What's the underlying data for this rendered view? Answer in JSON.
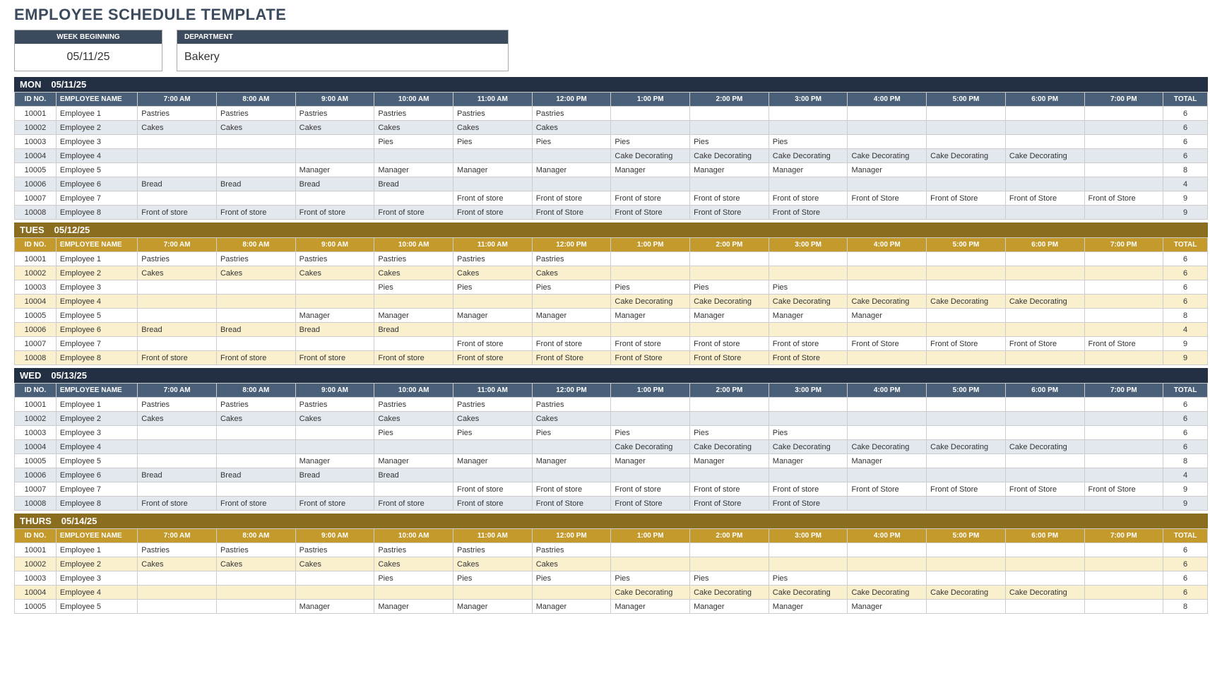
{
  "title": "EMPLOYEE SCHEDULE TEMPLATE",
  "header": {
    "week_label": "WEEK BEGINNING",
    "week_value": "05/11/25",
    "dept_label": "DEPARTMENT",
    "dept_value": "Bakery"
  },
  "columns": {
    "id": "ID NO.",
    "name": "EMPLOYEE NAME",
    "hours": [
      "7:00 AM",
      "8:00 AM",
      "9:00 AM",
      "10:00 AM",
      "11:00 AM",
      "12:00 PM",
      "1:00 PM",
      "2:00 PM",
      "3:00 PM",
      "4:00 PM",
      "5:00 PM",
      "6:00 PM",
      "7:00 PM"
    ],
    "total": "TOTAL"
  },
  "rows": [
    {
      "id": "10001",
      "name": "Employee 1",
      "cells": [
        "Pastries",
        "Pastries",
        "Pastries",
        "Pastries",
        "Pastries",
        "Pastries",
        "",
        "",
        "",
        "",
        "",
        "",
        ""
      ],
      "total": "6"
    },
    {
      "id": "10002",
      "name": "Employee 2",
      "cells": [
        "Cakes",
        "Cakes",
        "Cakes",
        "Cakes",
        "Cakes",
        "Cakes",
        "",
        "",
        "",
        "",
        "",
        "",
        ""
      ],
      "total": "6"
    },
    {
      "id": "10003",
      "name": "Employee 3",
      "cells": [
        "",
        "",
        "",
        "Pies",
        "Pies",
        "Pies",
        "Pies",
        "Pies",
        "Pies",
        "",
        "",
        "",
        ""
      ],
      "total": "6"
    },
    {
      "id": "10004",
      "name": "Employee 4",
      "cells": [
        "",
        "",
        "",
        "",
        "",
        "",
        "Cake Decorating",
        "Cake Decorating",
        "Cake Decorating",
        "Cake Decorating",
        "Cake Decorating",
        "Cake Decorating",
        ""
      ],
      "total": "6"
    },
    {
      "id": "10005",
      "name": "Employee 5",
      "cells": [
        "",
        "",
        "Manager",
        "Manager",
        "Manager",
        "Manager",
        "Manager",
        "Manager",
        "Manager",
        "Manager",
        "",
        "",
        ""
      ],
      "total": "8"
    },
    {
      "id": "10006",
      "name": "Employee 6",
      "cells": [
        "Bread",
        "Bread",
        "Bread",
        "Bread",
        "",
        "",
        "",
        "",
        "",
        "",
        "",
        "",
        ""
      ],
      "total": "4"
    },
    {
      "id": "10007",
      "name": "Employee 7",
      "cells": [
        "",
        "",
        "",
        "",
        "Front of store",
        "Front of store",
        "Front of store",
        "Front of store",
        "Front of store",
        "Front of Store",
        "Front of Store",
        "Front of Store",
        "Front of Store"
      ],
      "total": "9"
    },
    {
      "id": "10008",
      "name": "Employee 8",
      "cells": [
        "Front of store",
        "Front of store",
        "Front of store",
        "Front of store",
        "Front of store",
        "Front of Store",
        "Front of Store",
        "Front of Store",
        "Front of Store",
        "",
        "",
        "",
        ""
      ],
      "total": "9"
    }
  ],
  "days": [
    {
      "label": "MON",
      "date": "05/11/25",
      "theme": "navy",
      "rowcount": 8
    },
    {
      "label": "TUES",
      "date": "05/12/25",
      "theme": "gold",
      "rowcount": 8
    },
    {
      "label": "WED",
      "date": "05/13/25",
      "theme": "navy",
      "rowcount": 8
    },
    {
      "label": "THURS",
      "date": "05/14/25",
      "theme": "gold",
      "rowcount": 5
    }
  ]
}
